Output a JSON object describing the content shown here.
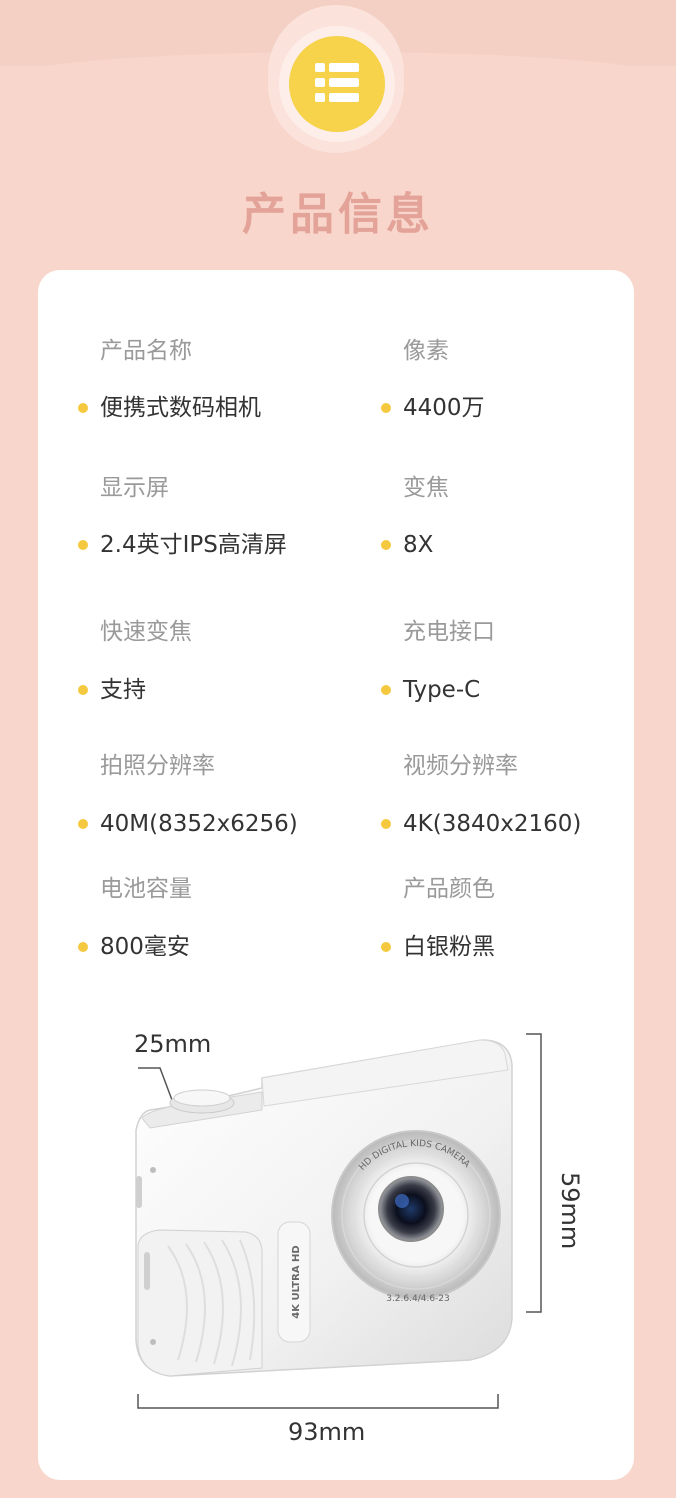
{
  "header": {
    "icon": "list-icon",
    "title": "产品信息",
    "accent_color": "#f6d34a",
    "title_color": "#e3a398"
  },
  "specs": [
    {
      "label": "产品名称",
      "value": "便携式数码相机"
    },
    {
      "label": "像素",
      "value": "4400万"
    },
    {
      "label": "显示屏",
      "value": "2.4英寸IPS高清屏"
    },
    {
      "label": "变焦",
      "value": "8X"
    },
    {
      "label": "快速变焦",
      "value": "支持"
    },
    {
      "label": "充电接口",
      "value": "Type-C"
    },
    {
      "label": "拍照分辨率",
      "value": "40M(8352x6256)"
    },
    {
      "label": "视频分辨率",
      "value": "4K(3840x2160)"
    },
    {
      "label": "电池容量",
      "value": "800毫安"
    },
    {
      "label": "产品颜色",
      "value": "白银粉黑"
    }
  ],
  "dimensions": {
    "depth": "25mm",
    "height": "59mm",
    "width": "93mm"
  },
  "camera": {
    "lens_ring_text": "HD DIGITAL KIDS CAMERA",
    "lens_spec_text": "3.2.6.4/4.6-23",
    "side_badge": "4K ULTRA HD"
  }
}
